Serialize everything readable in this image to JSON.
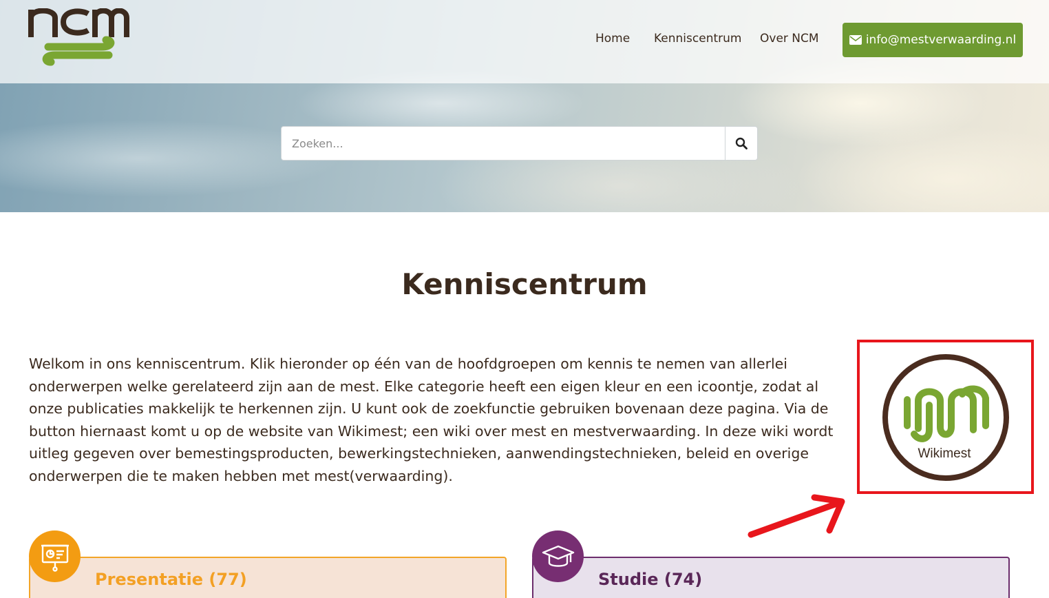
{
  "header": {
    "logo_text": "ncm",
    "nav": [
      {
        "label": "Home"
      },
      {
        "label": "Kenniscentrum"
      },
      {
        "label": "Over NCM"
      }
    ],
    "email_button": "info@mestverwaarding.nl"
  },
  "search": {
    "placeholder": "Zoeken..."
  },
  "main": {
    "title": "Kenniscentrum",
    "intro": "Welkom in ons kenniscentrum. Klik hieronder op één van de hoofdgroepen om kennis te nemen van allerlei onderwerpen welke gerelateerd zijn aan de mest. Elke categorie heeft een eigen kleur en een icoontje, zodat al onze publicaties makkelijk te herkennen zijn. U kunt ook de zoekfunctie gebruiken bovenaan deze pagina. Via de button hiernaast komt u op de website van Wikimest; een wiki over mest en mestverwaarding. In deze wiki wordt uitleg gegeven over bemestingsproducten, bewerkingstechnieken, aanwendingstechnieken, beleid en overige onderwerpen die te maken hebben met mest(verwaarding).",
    "wiki_label": "Wikimest"
  },
  "categories": [
    {
      "label": "Presentatie (77)",
      "icon": "presentation-icon",
      "color": "#f39c12"
    },
    {
      "label": "Studie (74)",
      "icon": "graduation-cap-icon",
      "color": "#772e72"
    }
  ],
  "colors": {
    "brand_brown": "#3b2a1e",
    "brand_green": "#6e9a31",
    "highlight_red": "#e8161c"
  }
}
